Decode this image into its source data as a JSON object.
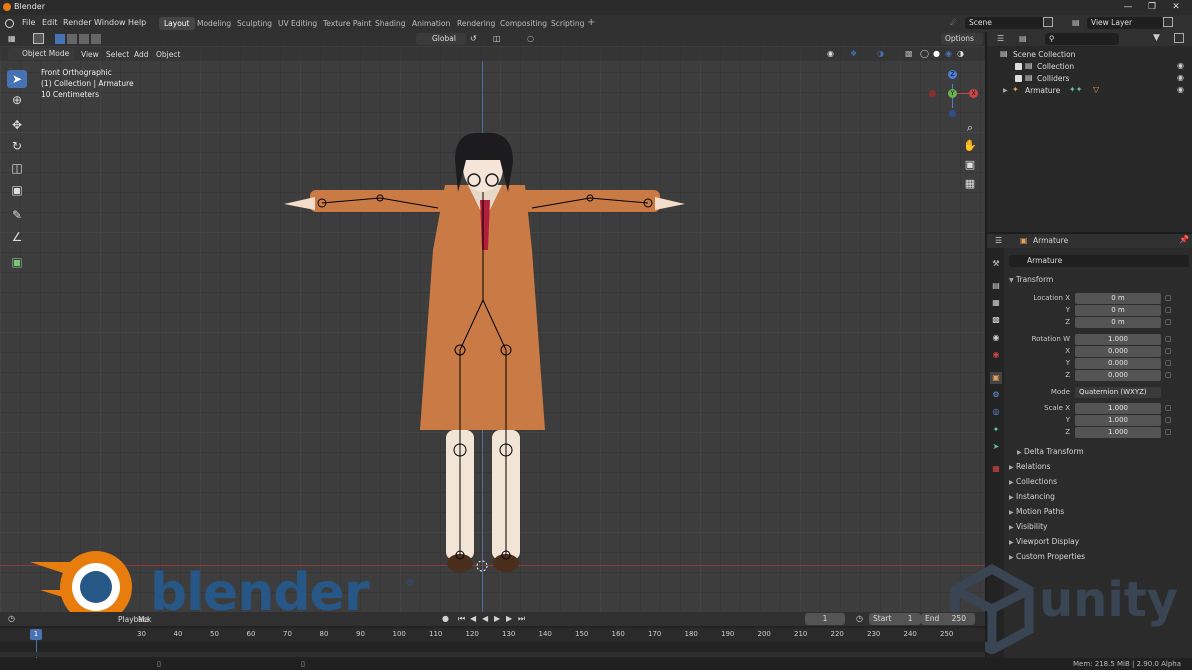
{
  "window": {
    "title": "Blender",
    "controls": [
      "—",
      "❐",
      "✕"
    ]
  },
  "menu": [
    "File",
    "Edit",
    "Render",
    "Window",
    "Help"
  ],
  "workspaces": [
    "Layout",
    "Modeling",
    "Sculpting",
    "UV Editing",
    "Texture Paint",
    "Shading",
    "Animation",
    "Rendering",
    "Compositing",
    "Scripting"
  ],
  "active_workspace": "Layout",
  "scene": {
    "name": "Scene",
    "view_layer": "View Layer"
  },
  "viewport": {
    "mode": "Object Mode",
    "menus": [
      "View",
      "Select",
      "Add",
      "Object"
    ],
    "orientation": "Global",
    "options": "Options",
    "overlay_lines": [
      "Front Orthographic",
      "(1) Collection | Armature",
      "10 Centimeters"
    ],
    "gizmo": {
      "z": "Z",
      "x": "X",
      "y": "Y"
    }
  },
  "outliner": {
    "rows": [
      {
        "label": "Scene Collection",
        "visible": false
      },
      {
        "label": "Collection",
        "visible": true
      },
      {
        "label": "Colliders",
        "visible": true
      },
      {
        "label": "Armature",
        "visible": true
      }
    ]
  },
  "properties": {
    "header_object": "Armature",
    "datablock": "Armature",
    "section": "Transform",
    "location": {
      "label": "Location X",
      "x": "0 m",
      "y": "0 m",
      "z": "0 m"
    },
    "rotation": {
      "label": "Rotation W",
      "w": "1.000",
      "x": "0.000",
      "y": "0.000",
      "z": "0.000"
    },
    "mode": {
      "label": "Mode",
      "value": "Quaternion (WXYZ)"
    },
    "scale": {
      "label": "Scale X",
      "x": "1.000",
      "y": "1.000",
      "z": "1.000"
    },
    "axis_labels": {
      "y": "Y",
      "z": "Z",
      "x": "X"
    },
    "delta": "Delta Transform",
    "panels": [
      "Relations",
      "Collections",
      "Instancing",
      "Motion Paths",
      "Visibility",
      "Viewport Display",
      "Custom Properties"
    ]
  },
  "timeline": {
    "playback": "Playback",
    "marker": "Ma",
    "current_frame": "1",
    "start_label": "Start",
    "start": "1",
    "end_label": "End",
    "end": "250",
    "ticks": [
      "30",
      "40",
      "50",
      "60",
      "70",
      "80",
      "90",
      "100",
      "110",
      "120",
      "130",
      "140",
      "150",
      "160",
      "170",
      "180",
      "190",
      "200",
      "210",
      "220",
      "230",
      "240",
      "250"
    ],
    "cursor_label": "1"
  },
  "status": {
    "memory": "Mem: 218.5 MiB | 2.90.0 Alpha"
  },
  "watermarks": {
    "left": "blender",
    "left_reg": "®",
    "right": "unity"
  },
  "colors": {
    "accent": "#4772b3",
    "blender_orange": "#e87d0d",
    "blender_blue": "#265787",
    "coat": "#c97a45"
  }
}
